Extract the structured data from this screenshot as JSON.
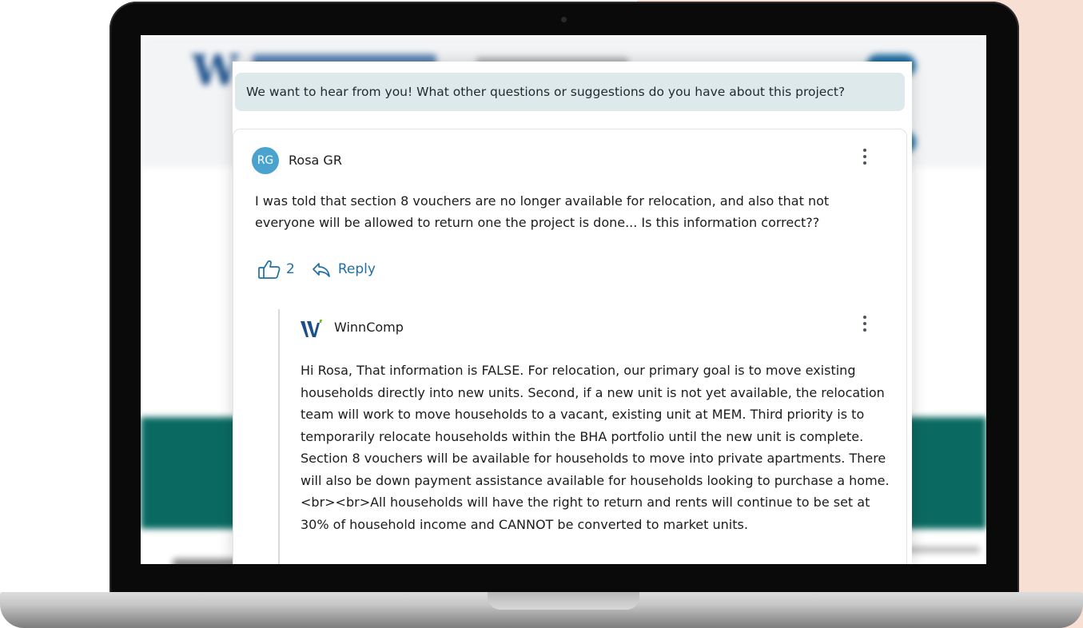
{
  "question": {
    "text": "We want to hear from you! What other questions or suggestions do you have about this project?"
  },
  "comment": {
    "avatar_initials": "RG",
    "author": "Rosa GR",
    "body": "I was told that section 8 vouchers are no longer available for relocation, and also that not everyone will be allowed to return one the project is done... Is this information correct??",
    "like_count": "2",
    "reply_label": "Reply",
    "menu_icon": "kebab-menu-icon",
    "like_icon": "thumbs-up-icon",
    "reply_icon": "reply-arrow-icon"
  },
  "reply": {
    "author": "WinnComp",
    "logo_icon": "winncompanies-logo-icon",
    "body": "Hi Rosa, That information is FALSE. For relocation, our primary goal is to move existing households directly into new units. Second, if a new unit is not yet available, the relocation team will work to move households to a vacant, existing unit at MEM. Third priority is to temporarily relocate households within the BHA portfolio until the new unit is complete. Section 8 vouchers will be available for households to move into private apartments. There will also be down payment assistance available for households looking to purchase a home. <br><br>All households will have the right to return and rents will continue to be set at 30% of household income and CANNOT be converted to market units."
  },
  "colors": {
    "accent": "#1e6fa5",
    "avatar": "#4aa3cf",
    "banner": "#dde9ea",
    "peach": "#f8dfd3",
    "teal": "#0a6a62"
  }
}
